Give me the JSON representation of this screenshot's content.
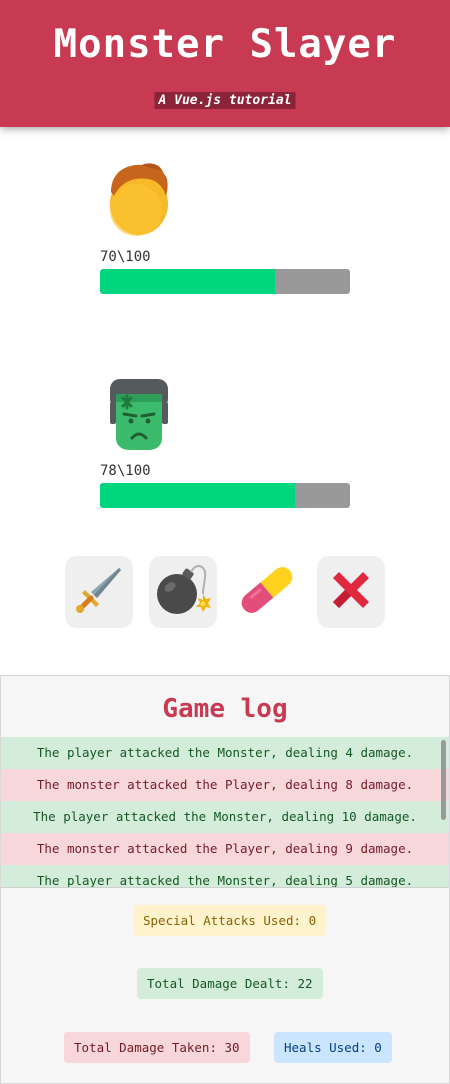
{
  "header": {
    "title": "Monster Slayer",
    "subtitle": "A Vue.js tutorial"
  },
  "player": {
    "avatar_icon": "player-face-icon",
    "hp_text": "70\\100",
    "hp_fraction": 0.7
  },
  "monster": {
    "avatar_icon": "monster-face-icon",
    "hp_text": "78\\100",
    "hp_fraction": 0.78
  },
  "actions": [
    {
      "name": "attack",
      "icon": "sword-icon"
    },
    {
      "name": "special-attack",
      "icon": "bomb-icon"
    },
    {
      "name": "heal",
      "icon": "pill-icon"
    },
    {
      "name": "give-up",
      "icon": "cross-icon"
    }
  ],
  "log": {
    "title": "Game log",
    "entries": [
      {
        "type": "player",
        "text": "The player attacked the Monster, dealing 4 damage."
      },
      {
        "type": "monster",
        "text": "The monster attacked the Player, dealing 8 damage."
      },
      {
        "type": "player",
        "text": "The player attacked the Monster, dealing 10 damage."
      },
      {
        "type": "monster",
        "text": "The monster attacked the Player, dealing 9 damage."
      },
      {
        "type": "player",
        "text": "The player attacked the Monster, dealing 5 damage."
      }
    ]
  },
  "stats": {
    "special_attacks": "Special Attacks Used: 0",
    "damage_dealt": "Total Damage Dealt: 22",
    "damage_taken": "Total Damage Taken: 30",
    "heals": "Heals Used: 0"
  },
  "colors": {
    "brand": "#c73a52",
    "health": "#00d67d",
    "health_track": "#999999"
  }
}
